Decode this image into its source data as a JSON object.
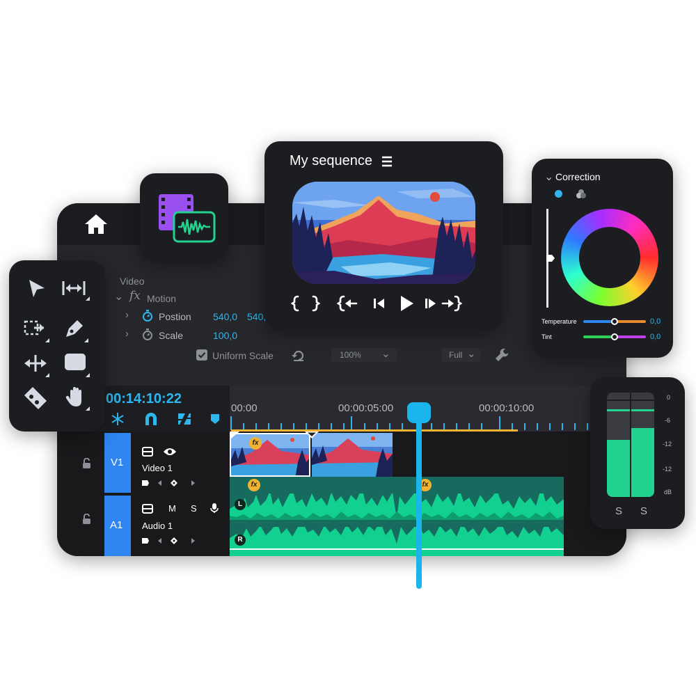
{
  "effects": {
    "section": "Video",
    "motion": "Motion",
    "position": {
      "label": "Postion",
      "x": "540,0",
      "y": "540,"
    },
    "scale": {
      "label": "Scale",
      "value": "100,0"
    },
    "uniform_scale": "Uniform Scale",
    "zoom": "100%",
    "quality": "Full"
  },
  "timeline": {
    "timecode": "00:14:10:22",
    "ruler": [
      "00:00",
      "00:00:05:00",
      "00:00:10:00"
    ],
    "playhead_fraction": 0.27,
    "tracks": {
      "v1": {
        "id": "V1",
        "name": "Video 1"
      },
      "a1": {
        "id": "A1",
        "name": "Audio 1",
        "mute": "M",
        "solo": "S"
      }
    },
    "channel_left": "L",
    "channel_right": "R",
    "fx": "fx"
  },
  "program": {
    "title": "My sequence"
  },
  "correction": {
    "title": "Correction",
    "temperature": {
      "label": "Temperature",
      "value": "0,0"
    },
    "tint": {
      "label": "Tint",
      "value": "0,0"
    }
  },
  "meter": {
    "scale": [
      "0",
      "-6",
      "-12",
      "-12",
      "dB"
    ],
    "solo_left": "S",
    "solo_right": "S",
    "level_left": 0.55,
    "level_right": 0.66
  },
  "colors": {
    "accent": "#2eb6ee",
    "audio": "#12d08f",
    "work_area": "#f2b233",
    "panel": "#1c1d21"
  }
}
